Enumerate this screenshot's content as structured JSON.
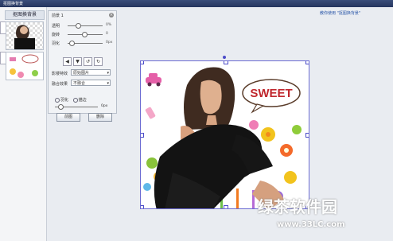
{
  "window": {
    "title": "抠图换背景"
  },
  "left_panel": {
    "tab_label": "抠图换背景"
  },
  "link": {
    "text": "教你使用 \"抠图换背景\""
  },
  "settings": {
    "header": "前景 1",
    "close": "×",
    "sliders": [
      {
        "label": "透明",
        "value": "0%"
      },
      {
        "label": "旋转",
        "value": "0"
      },
      {
        "label": "羽化",
        "value": "0px"
      }
    ],
    "fields": [
      {
        "label": "影楼特效",
        "value": "原始图片"
      },
      {
        "label": "融合效果",
        "value": "不融合"
      }
    ],
    "radio": {
      "a": "羽化",
      "b": "描边"
    },
    "small_value": "0px",
    "buttons": {
      "apply": "前图",
      "delete": "删除"
    }
  },
  "artwork": {
    "bubble_text": "SWEET"
  },
  "watermark": {
    "text": "绿茶软件园",
    "url": "www.33LC.com"
  }
}
